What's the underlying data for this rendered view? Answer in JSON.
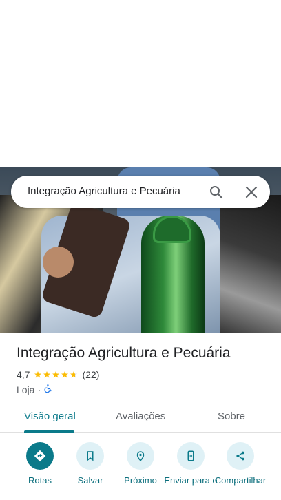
{
  "search": {
    "query": "Integração Agricultura e Pecuária"
  },
  "place": {
    "title": "Integração Agricultura e Pecuária",
    "rating": "4,7",
    "stars": 4.7,
    "reviews": "(22)",
    "category": "Loja",
    "separator": "·"
  },
  "tabs": [
    {
      "label": "Visão geral",
      "active": true
    },
    {
      "label": "Avaliações",
      "active": false
    },
    {
      "label": "Sobre",
      "active": false
    }
  ],
  "actions": [
    {
      "label": "Rotas",
      "icon": "directions-icon"
    },
    {
      "label": "Salvar",
      "icon": "bookmark-icon"
    },
    {
      "label": "Próximo",
      "icon": "nearby-icon"
    },
    {
      "label": "Enviar para o",
      "icon": "send-to-phone-icon"
    },
    {
      "label": "Compartilhar",
      "icon": "share-icon"
    }
  ],
  "colors": {
    "accent": "#0b7a8a",
    "star": "#fbbc04",
    "chip_bg": "#dff1f6"
  }
}
